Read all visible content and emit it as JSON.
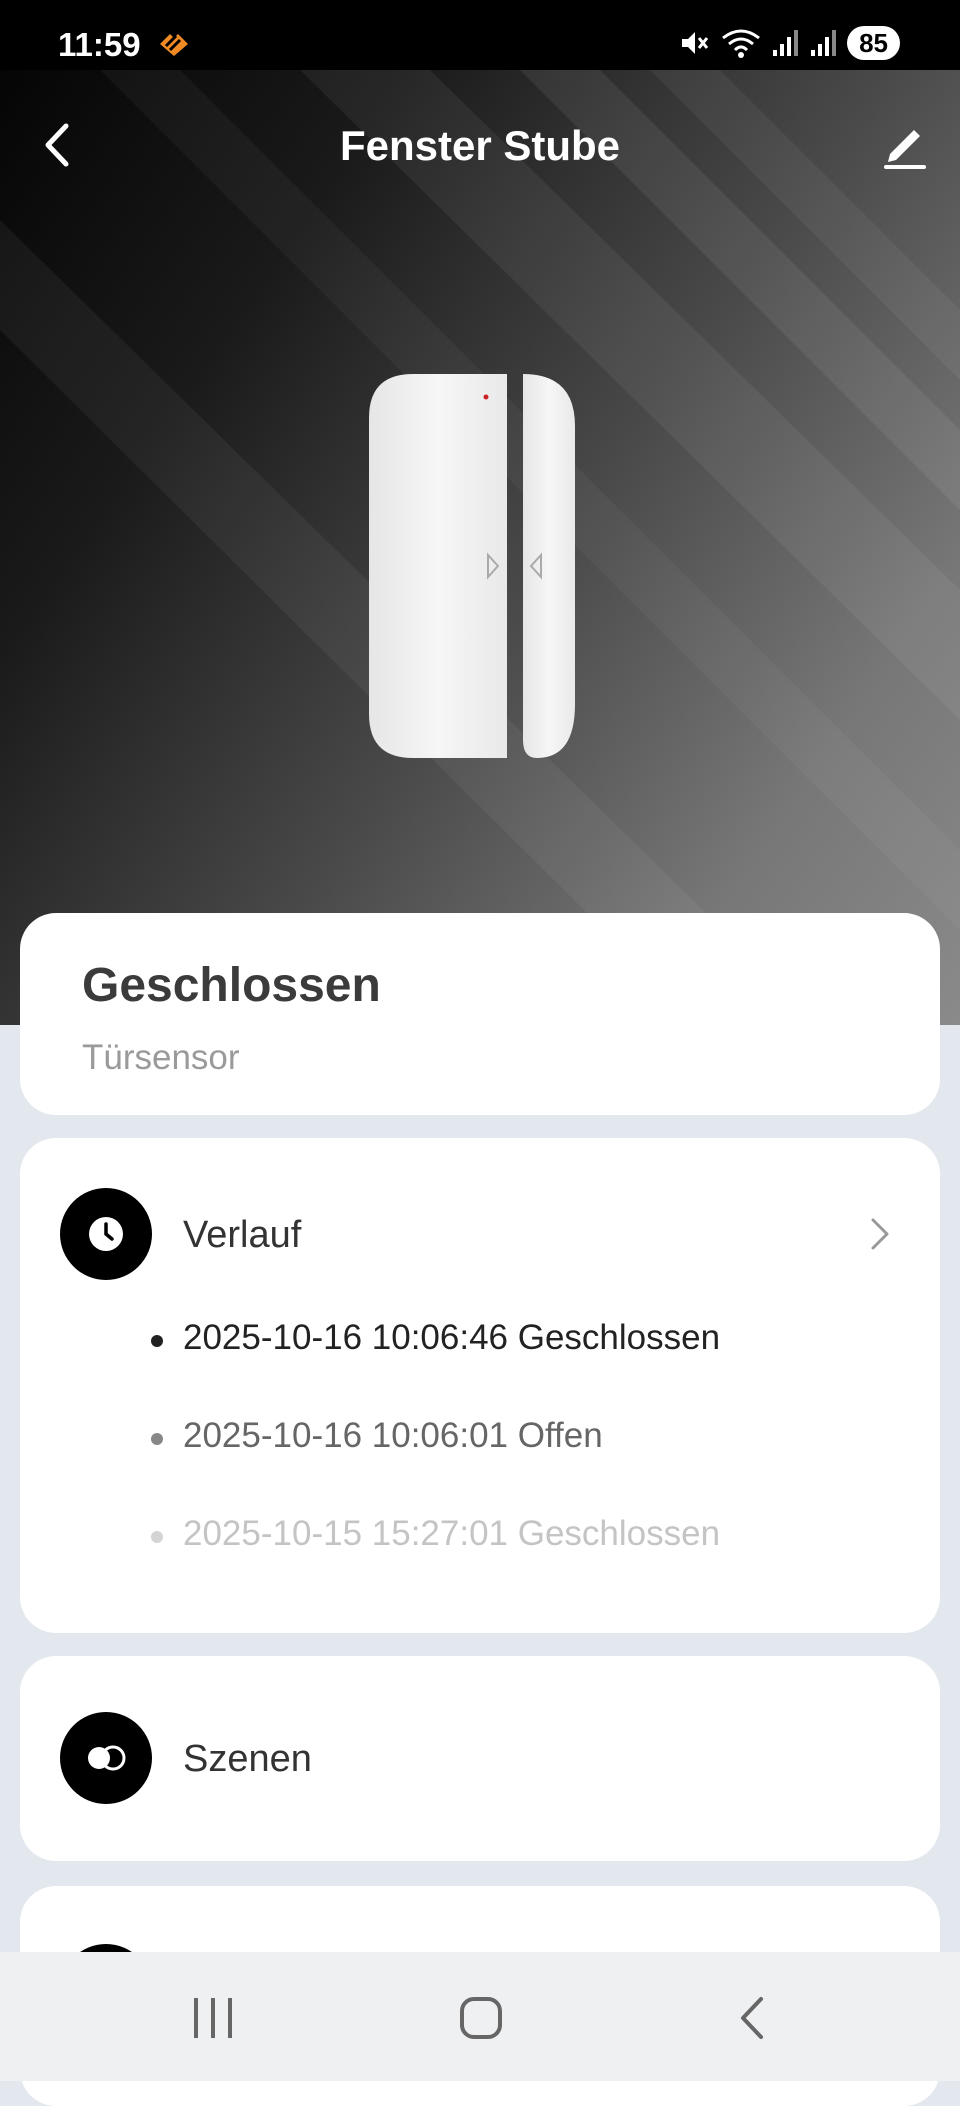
{
  "status_bar": {
    "time": "11:59",
    "battery": "85"
  },
  "header": {
    "title": "Fenster Stube"
  },
  "device_status": {
    "state": "Geschlossen",
    "type": "Türsensor"
  },
  "history": {
    "label": "Verlauf",
    "entries": [
      {
        "text": "2025-10-16 10:06:46 Geschlossen",
        "color": "#222222"
      },
      {
        "text": "2025-10-16 10:06:01 Offen",
        "color": "#666666"
      },
      {
        "text": "2025-10-15 15:27:01 Geschlossen",
        "color": "#c4c4c4"
      }
    ]
  },
  "scenes": {
    "label": "Szenen"
  },
  "icons": {
    "back": "chevron-left-icon",
    "edit": "pencil-icon",
    "history": "clock-icon",
    "scenes": "scenes-icon",
    "nav_recent": "recent-apps-icon",
    "nav_home": "home-icon",
    "nav_back": "back-icon"
  }
}
